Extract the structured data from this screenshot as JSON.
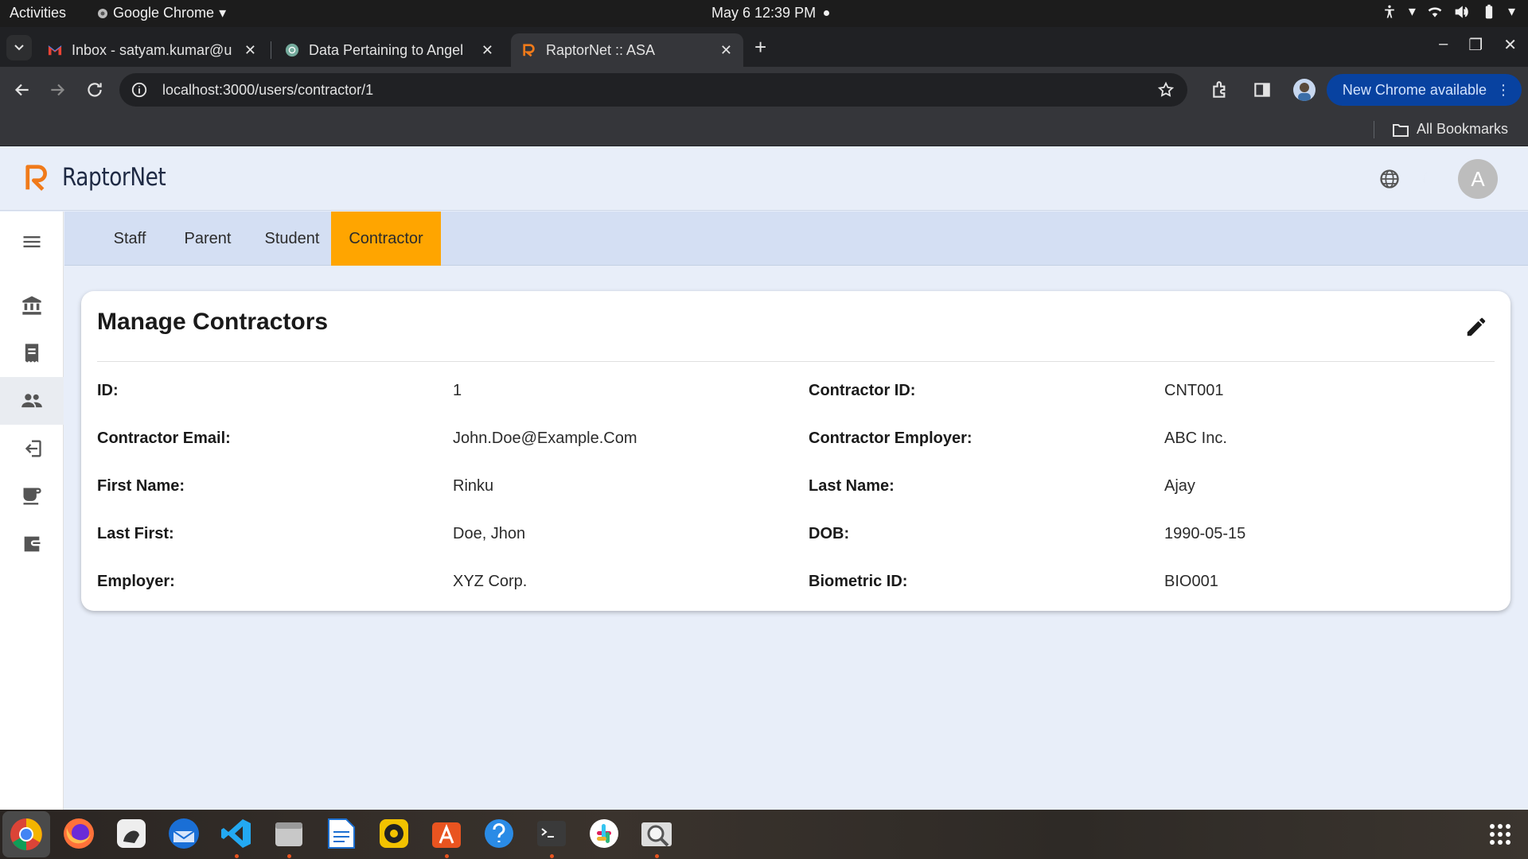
{
  "system_bar": {
    "activities": "Activities",
    "app_name": "Google Chrome",
    "clock": "May 6  12:39 PM"
  },
  "browser": {
    "tabs": [
      {
        "title": "Inbox - satyam.kumar@u",
        "favicon": "gmail-icon"
      },
      {
        "title": "Data Pertaining to Angel",
        "favicon": "chatgpt-icon"
      },
      {
        "title": "RaptorNet :: ASA",
        "favicon": "raptornet-icon"
      }
    ],
    "url": "localhost:3000/users/contractor/1",
    "update_button": "New Chrome available",
    "all_bookmarks": "All Bookmarks"
  },
  "app": {
    "brand": "RaptorNet",
    "avatar_letter": "A",
    "accent_color": "#ffa500",
    "nav_tabs": [
      "Staff",
      "Parent",
      "Student",
      "Contractor"
    ],
    "active_tab": "Contractor",
    "sidebar_icons": [
      "menu-icon",
      "institution-icon",
      "receipt-icon",
      "people-icon",
      "login-icon",
      "cafe-icon",
      "wallet-icon"
    ]
  },
  "card": {
    "title": "Manage Contractors",
    "fields": [
      {
        "label": "ID:",
        "value": "1"
      },
      {
        "label": "Contractor ID:",
        "value": "CNT001"
      },
      {
        "label": "Contractor Email:",
        "value": "John.Doe@Example.Com"
      },
      {
        "label": "Contractor Employer:",
        "value": "ABC Inc."
      },
      {
        "label": "First Name:",
        "value": "Rinku"
      },
      {
        "label": "Last Name:",
        "value": "Ajay"
      },
      {
        "label": "Last First:",
        "value": "Doe, Jhon"
      },
      {
        "label": "DOB:",
        "value": "1990-05-15"
      },
      {
        "label": "Employer:",
        "value": "XYZ Corp."
      },
      {
        "label": "Biometric ID:",
        "value": "BIO001"
      }
    ]
  },
  "dock": [
    "chrome-icon",
    "firefox-icon",
    "gimp-icon",
    "thunderbird-icon",
    "vscode-icon",
    "files-icon",
    "writer-icon",
    "rhythmbox-icon",
    "app-center-icon",
    "help-icon",
    "terminal-icon",
    "slack-icon",
    "image-viewer-icon"
  ]
}
